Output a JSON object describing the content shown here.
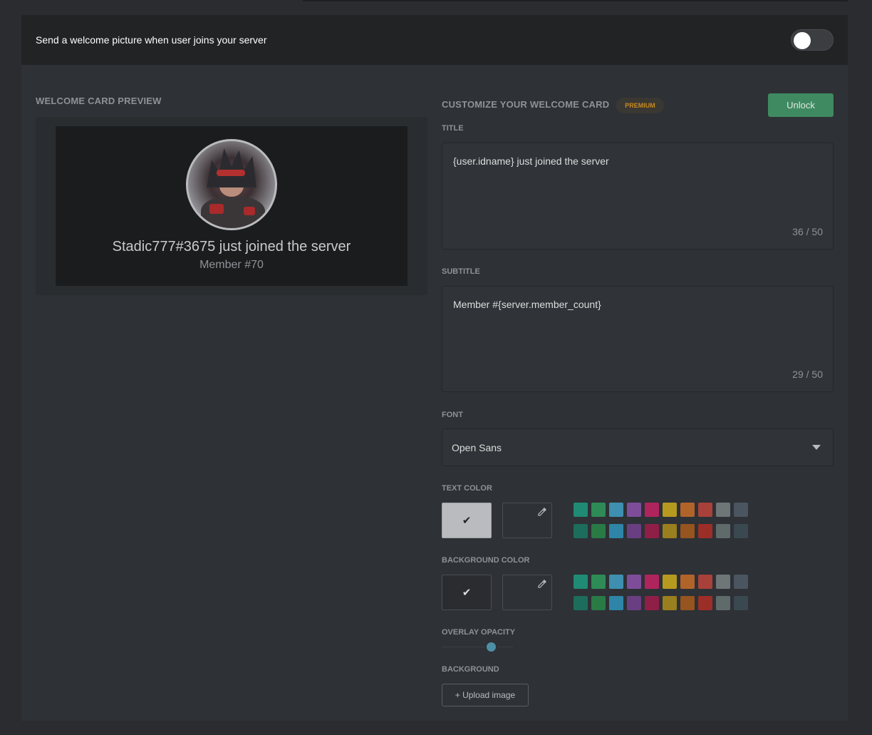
{
  "header": {
    "text": "Send a welcome picture when user joins your server",
    "toggle_on": false
  },
  "preview": {
    "label": "WELCOME CARD PREVIEW",
    "title": "Stadic777#3675 just joined the server",
    "subtitle": "Member #70"
  },
  "customize": {
    "label": "CUSTOMIZE YOUR WELCOME CARD",
    "badge": "PREMIUM",
    "unlock_label": "Unlock"
  },
  "title_field": {
    "label": "TITLE",
    "value": "{user.idname} just joined the server",
    "count": "36 / 50"
  },
  "subtitle_field": {
    "label": "SUBTITLE",
    "value": "Member #{server.member_count}",
    "count": "29 / 50"
  },
  "font_field": {
    "label": "FONT",
    "value": "Open Sans"
  },
  "text_color": {
    "label": "TEXT COLOR",
    "check": "✔"
  },
  "background_color": {
    "label": "BACKGROUND COLOR",
    "check": "✔"
  },
  "palette": {
    "row1": [
      "#1f8b75",
      "#2e8b55",
      "#3f8fb0",
      "#7e4d99",
      "#b0245e",
      "#b59a1f",
      "#b0642a",
      "#a8413a",
      "#6f7678",
      "#4a5560"
    ],
    "row2": [
      "#1d6d5c",
      "#2a7a45",
      "#2e85a8",
      "#6a3f82",
      "#8f1f47",
      "#9a7f1f",
      "#96541f",
      "#9c2e28",
      "#5f6a6b",
      "#3a4850"
    ]
  },
  "overlay_opacity": {
    "label": "OVERLAY OPACITY",
    "value_fraction": 0.7
  },
  "background": {
    "label": "BACKGROUND",
    "upload_label": "+ Upload image"
  }
}
